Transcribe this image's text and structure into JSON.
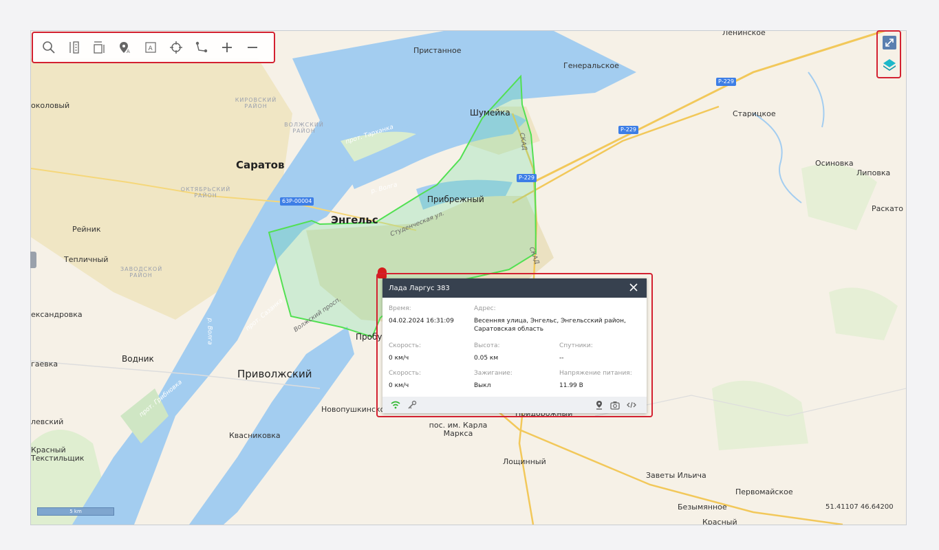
{
  "toolbar": {
    "tools": [
      {
        "id": "search",
        "icon": "search-icon"
      },
      {
        "id": "ruler",
        "icon": "ruler-icon"
      },
      {
        "id": "area",
        "icon": "area-measure-icon"
      },
      {
        "id": "poi",
        "icon": "poi-marker-icon"
      },
      {
        "id": "label",
        "icon": "text-label-icon"
      },
      {
        "id": "locate",
        "icon": "crosshair-icon"
      },
      {
        "id": "route",
        "icon": "route-icon"
      },
      {
        "id": "zoom_in",
        "icon": "plus-icon"
      },
      {
        "id": "zoom_out",
        "icon": "minus-icon"
      }
    ]
  },
  "map_controls": {
    "fullscreen_icon": "fullscreen-icon",
    "layers_icon": "layers-icon"
  },
  "map_labels": {
    "pristannoe": "Пристанное",
    "generalskoe": "Генеральское",
    "leninskoe": "Ленинское",
    "sokolovy": "околовый",
    "kirovsky": "КИРОВСКИЙ РАЙОН",
    "volzhsky": "ВОЛЖСКИЙ РАЙОН",
    "saratov": "Саратов",
    "oktyabrsky": "ОКТЯБРЬСКИЙ РАЙОН",
    "prot_tarhanka": "прот. Тарханка",
    "shumeyka": "Шумейка",
    "staritskoe": "Старицкое",
    "osinovka": "Осиновка",
    "lipovka": "Липовка",
    "raskato": "Раскато",
    "river_volga": "р. Волга",
    "river_volga2": "р. Волга",
    "pribrezhny": "Прибрежный",
    "engels": "Энгельс",
    "studencheskaya": "Студенческая ул.",
    "reynik": "Рейник",
    "teplichny": "Тепличный",
    "zavodskoy": "ЗАВОДСКОЙ РАЙОН",
    "aleksandrovka": "ександровка",
    "prot_sazanka": "прот. Сазанка",
    "volzhsky_prosp": "Волжский просп.",
    "probuda": "Пробуд",
    "vodnik": "Водник",
    "gaevka": "гаевка",
    "privolzhsky": "Приволжский",
    "prot_gribnovka": "прот. Грибновка",
    "novopushkinskoe": "Новопушкинское",
    "pridorozhny": "Придорожный",
    "levsky": "левский",
    "kvasnikovka": "Квасниковка",
    "karla_marksa": "пос. им. Карла Маркса",
    "krasny_tekst": "Красный Текстильщик",
    "loshinny": "Лощинный",
    "zavety": "Заветы Ильича",
    "pervomayskoe": "Первомайское",
    "bezymyannoe": "Безымянное",
    "krasny": "Красный",
    "skad": "СКАД",
    "skad2": "СКАД"
  },
  "road_shields": {
    "r229a": "Р-229",
    "r229b": "Р-229",
    "r229c": "Р-229",
    "r63": "63Р-00004"
  },
  "popup": {
    "title": "Лада Ларгус 383",
    "time_label": "Время:",
    "time_value": "04.02.2024 16:31:09",
    "address_label": "Адрес:",
    "address_value": "Весенняя улица, Энгельс, Энгельсский район, Саратовская область",
    "speed_label": "Скорость:",
    "speed_value": "0 км/ч",
    "altitude_label": "Высота:",
    "altitude_value": "0.05 км",
    "satellites_label": "Спутники:",
    "satellites_value": "--",
    "speed2_label": "Скорость:",
    "speed2_value": "0 км/ч",
    "ignition_label": "Зажигание:",
    "ignition_value": "Выкл",
    "voltage_label": "Напряжение питания:",
    "voltage_value": "11.99 В"
  },
  "scale": "5 km",
  "coords": "51.41107 46.64200",
  "colors": {
    "geofence": "#52e052",
    "water": "#a3cdf0",
    "accent": "#d32030"
  }
}
